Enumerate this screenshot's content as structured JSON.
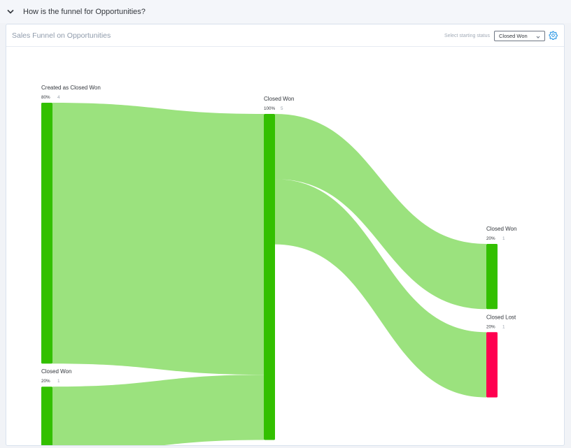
{
  "header": {
    "question": "How is the funnel for Opportunities?",
    "collapse_icon": "chevron-down-icon"
  },
  "card": {
    "title": "Sales Funnel on Opportunities",
    "status_label": "Select starting status",
    "status_value": "Closed Won",
    "settings_icon": "gear-icon",
    "accent": "#1a8fe3"
  },
  "chart_data": {
    "type": "sankey",
    "title": "Sales Funnel on Opportunities",
    "colors": {
      "won_node": "#33c000",
      "lost_node": "#ff0050",
      "link": "#9be27e",
      "link_highlight": "#6ad242"
    },
    "total": 5,
    "nodes": [
      {
        "id": "created",
        "column": 0,
        "name": "Created as Closed Won",
        "percent": "80%",
        "count": 4,
        "color": "#33c000"
      },
      {
        "id": "won_prev",
        "column": 0,
        "name": "Closed Won",
        "percent": "20%",
        "count": 1,
        "color": "#33c000"
      },
      {
        "id": "won_mid",
        "column": 1,
        "name": "Closed Won",
        "percent": "100%",
        "count": 5,
        "color": "#33c000"
      },
      {
        "id": "won_end",
        "column": 2,
        "name": "Closed Won",
        "percent": "20%",
        "count": 1,
        "color": "#33c000"
      },
      {
        "id": "lost_end",
        "column": 2,
        "name": "Closed Lost",
        "percent": "20%",
        "count": 1,
        "color": "#ff0050"
      }
    ],
    "links": [
      {
        "source": "created",
        "target": "won_mid",
        "value": 4
      },
      {
        "source": "won_prev",
        "target": "won_mid",
        "value": 1
      },
      {
        "source": "won_mid",
        "target": "won_end",
        "value": 1
      },
      {
        "source": "won_mid",
        "target": "lost_end",
        "value": 1
      }
    ]
  }
}
